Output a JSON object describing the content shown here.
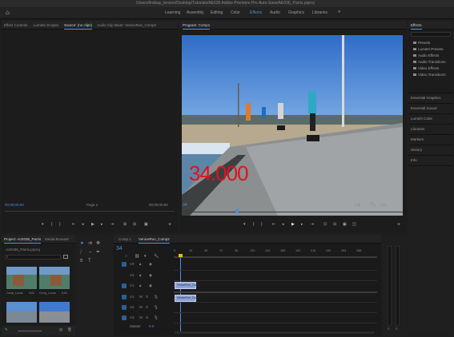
{
  "window": {
    "title": "/Users/lindsay_lenson/Desktop/Tutorials/AE036 Adobe Premiere Pro Auto-Save/AE036_Parris.prproj"
  },
  "workspaces": {
    "home_icon": "home-icon",
    "items": [
      "Learning",
      "Assembly",
      "Editing",
      "Color",
      "Effects",
      "Audio",
      "Graphics",
      "Libraries"
    ],
    "active": "Effects",
    "overflow_icon": "double-chevron-right-icon"
  },
  "source_panel": {
    "tabs": [
      "Effect Controls",
      "Lumetri Scopes",
      "Source: (no clips)",
      "Audio Clip Mixer: VeniceRun_Comp2"
    ],
    "active_tab": "Source: (no clips)",
    "timecode_left": "00;00;00;00",
    "page_label": "Page 1",
    "timecode_right": "00;00;00;00"
  },
  "program_panel": {
    "tab": "Program: Comp1",
    "overlay_number": "34.000",
    "frame_readout": "34",
    "zoom": "50%",
    "resolution": "Full",
    "duration_readout": "132",
    "wrench_icon": "wrench-icon"
  },
  "effects_panel": {
    "title": "Effects",
    "search_placeholder": "",
    "items": [
      "Presets",
      "Lumetri Presets",
      "Audio Effects",
      "Audio Transitions",
      "Video Effects",
      "Video Transitions"
    ]
  },
  "side_panels": [
    "Essential Graphics",
    "Essential Sound",
    "Lumetri Color",
    "Libraries",
    "Markers",
    "History",
    "Info"
  ],
  "project_panel": {
    "tabs": [
      "Project: AcE036_Parris",
      "Media Browser"
    ],
    "file_label": "AcE036_Parris.prproj",
    "thumbnails": [
      {
        "name": "Comp_Lucas",
        "duration": "5;00"
      },
      {
        "name": "Comp_Lucas",
        "duration": "5;00"
      },
      {
        "name": "",
        "duration": ""
      },
      {
        "name": "",
        "duration": ""
      }
    ]
  },
  "timeline": {
    "tabs": [
      "Comp 1",
      "VeniceRun_Comp2"
    ],
    "active_tab": "VeniceRun_Comp2",
    "playhead_frame": "34",
    "ruler": [
      "0",
      "24",
      "48",
      "72",
      "96",
      "120",
      "144",
      "168",
      "192",
      "216",
      "240",
      "264",
      "288"
    ],
    "video_tracks": [
      "V3",
      "V2",
      "V1"
    ],
    "audio_tracks": [
      "A1",
      "A2",
      "A3"
    ],
    "master_label": "Master",
    "master_value": "0.0",
    "clips": [
      {
        "name": "VeniceRun_Comp2",
        "track": "V1"
      },
      {
        "name": "VeniceRun_Comp2",
        "track": "A1"
      }
    ]
  },
  "transport": {
    "icons": [
      "marker-icon",
      "in-point-icon",
      "out-point-icon",
      "go-to-in-icon",
      "step-back-icon",
      "play-icon",
      "step-forward-icon",
      "go-to-out-icon",
      "lift-icon",
      "extract-icon",
      "export-frame-icon",
      "comparison-icon",
      "add-icon"
    ]
  },
  "colors": {
    "accent": "#4d8ee0",
    "overlay_text": "#e0121a",
    "panel_bg": "#1c1c1c",
    "clip_fill": "#8fa4d6"
  }
}
